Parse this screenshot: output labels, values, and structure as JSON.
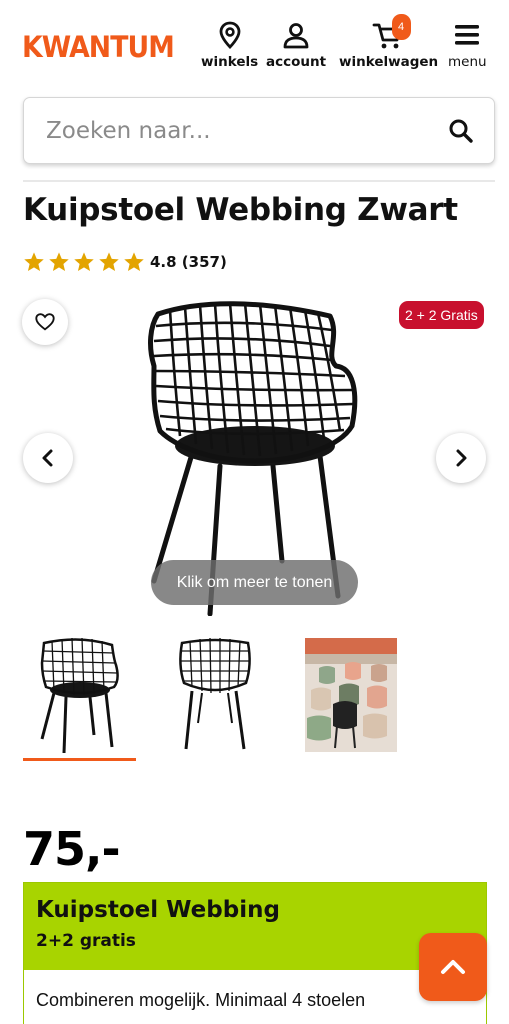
{
  "header": {
    "logo": "KWANTUM",
    "nav": {
      "stores": "winkels",
      "account": "account",
      "cart": "winkelwagen",
      "cart_count": "4",
      "menu": "menu"
    }
  },
  "search": {
    "placeholder": "Zoeken naar..."
  },
  "product": {
    "title": "Kuipstoel Webbing Zwart",
    "rating": 4.8,
    "rating_text": "4.8 (357)",
    "promo_badge": "2 + 2 Gratis",
    "show_more": "Klik om meer te tonen",
    "price": "75,-",
    "selected_thumbnail": 1
  },
  "promo": {
    "title": "Kuipstoel Webbing",
    "subtitle": "2+2 gratis",
    "body": "Combineren mogelijk. Minimaal 4 stoelen"
  },
  "colors": {
    "brand_orange": "#f05a1a",
    "promo_red": "#c8102e",
    "promo_green": "#a8d400",
    "star": "#e3a400"
  },
  "icons": [
    "location-pin-icon",
    "user-icon",
    "cart-icon",
    "hamburger-menu-icon",
    "search-icon",
    "star-icon",
    "heart-icon",
    "chevron-left-icon",
    "chevron-right-icon",
    "chevron-up-icon"
  ]
}
